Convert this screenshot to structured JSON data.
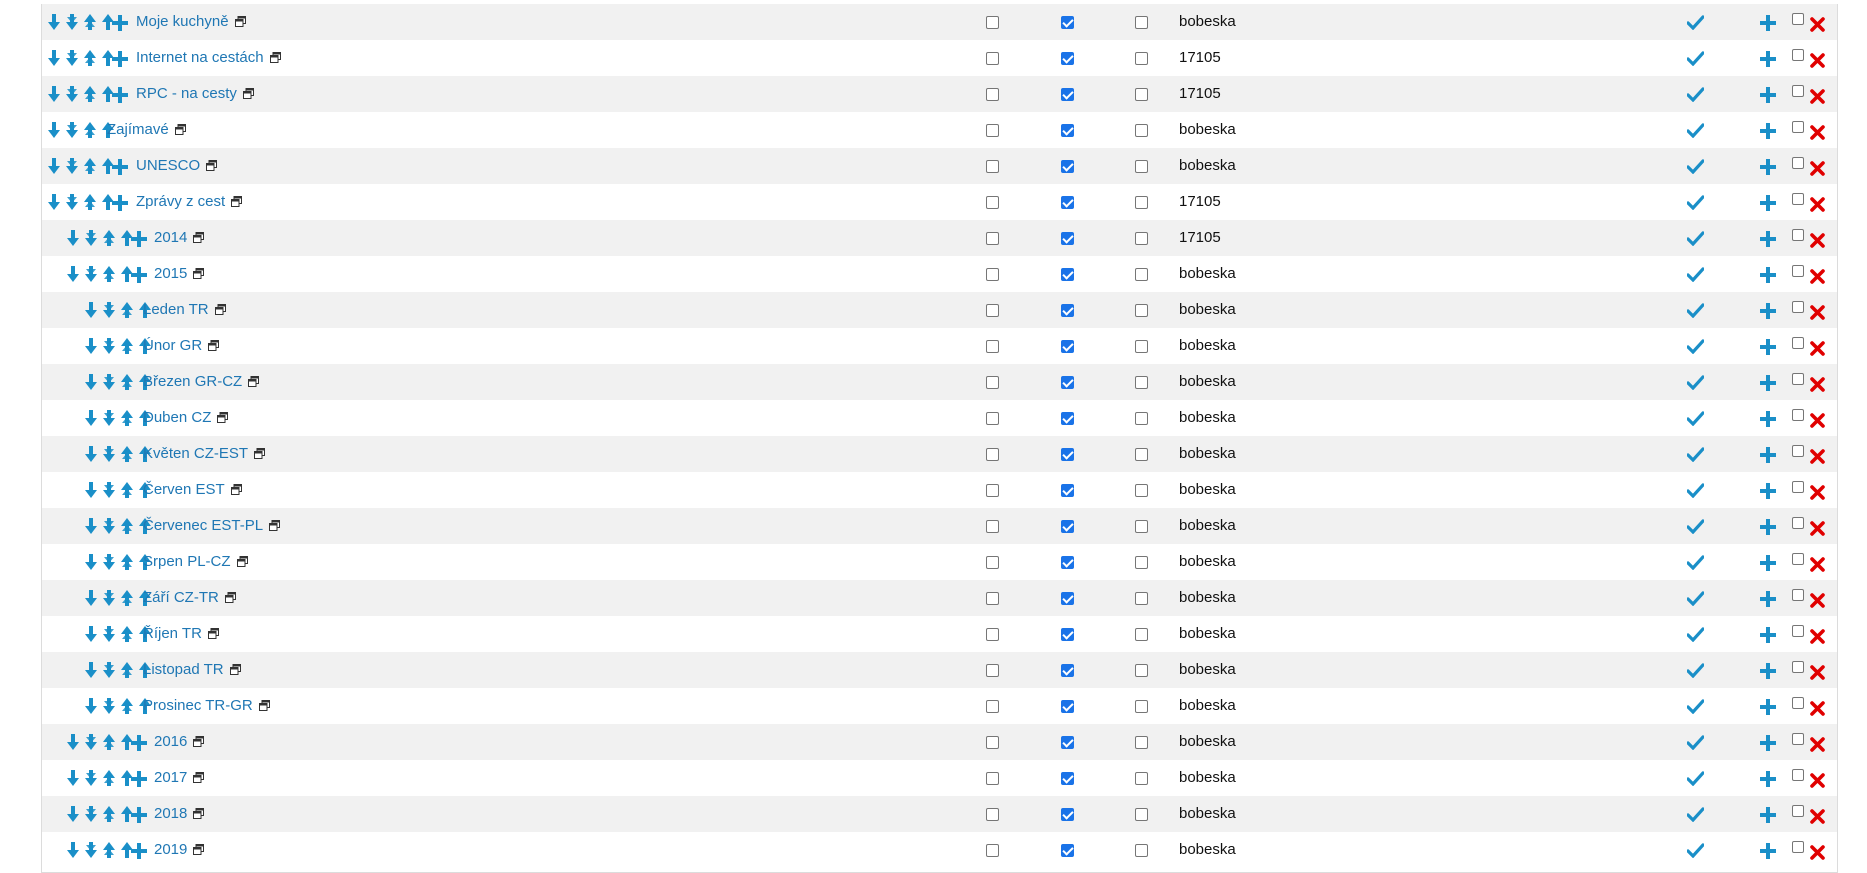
{
  "colors": {
    "link": "#1f77b4",
    "accent_blue": "#1a8fc8",
    "delete_red": "#e00000",
    "checkbox_on": "#1a73e8",
    "row_alt": "#f1f1f1"
  },
  "icons": {
    "move": [
      "arrow-down-icon",
      "arrow-down-fast-icon",
      "arrow-up-fast-icon",
      "arrow-up-icon"
    ],
    "add": "plus-icon",
    "open": "open-window-icon",
    "publish": "checkmark-icon",
    "delete": "red-x-icon"
  },
  "rows": [
    {
      "title": "Moje kuchyně",
      "level": 0,
      "plus": true,
      "cb1": false,
      "cb2": true,
      "cb3": false,
      "owner": "bobeska"
    },
    {
      "title": "Internet na cestách",
      "level": 0,
      "plus": true,
      "cb1": false,
      "cb2": true,
      "cb3": false,
      "owner": "17105"
    },
    {
      "title": "RPC - na cesty",
      "level": 0,
      "plus": true,
      "cb1": false,
      "cb2": true,
      "cb3": false,
      "owner": "17105"
    },
    {
      "title": "Zajímavé",
      "level": 0,
      "plus": false,
      "cb1": false,
      "cb2": true,
      "cb3": false,
      "owner": "bobeska"
    },
    {
      "title": "UNESCO",
      "level": 0,
      "plus": true,
      "cb1": false,
      "cb2": true,
      "cb3": false,
      "owner": "bobeska"
    },
    {
      "title": "Zprávy z cest",
      "level": 0,
      "plus": true,
      "cb1": false,
      "cb2": true,
      "cb3": false,
      "owner": "17105"
    },
    {
      "title": "2014",
      "level": 1,
      "plus": true,
      "cb1": false,
      "cb2": true,
      "cb3": false,
      "owner": "17105"
    },
    {
      "title": "2015",
      "level": 1,
      "plus": true,
      "cb1": false,
      "cb2": true,
      "cb3": false,
      "owner": "bobeska"
    },
    {
      "title": "Leden TR",
      "level": 2,
      "plus": false,
      "cb1": false,
      "cb2": true,
      "cb3": false,
      "owner": "bobeska"
    },
    {
      "title": "Únor GR",
      "level": 2,
      "plus": false,
      "cb1": false,
      "cb2": true,
      "cb3": false,
      "owner": "bobeska"
    },
    {
      "title": "Březen GR-CZ",
      "level": 2,
      "plus": false,
      "cb1": false,
      "cb2": true,
      "cb3": false,
      "owner": "bobeska"
    },
    {
      "title": "Duben CZ",
      "level": 2,
      "plus": false,
      "cb1": false,
      "cb2": true,
      "cb3": false,
      "owner": "bobeska"
    },
    {
      "title": "Květen CZ-EST",
      "level": 2,
      "plus": false,
      "cb1": false,
      "cb2": true,
      "cb3": false,
      "owner": "bobeska"
    },
    {
      "title": "Červen EST",
      "level": 2,
      "plus": false,
      "cb1": false,
      "cb2": true,
      "cb3": false,
      "owner": "bobeska"
    },
    {
      "title": "Červenec EST-PL",
      "level": 2,
      "plus": false,
      "cb1": false,
      "cb2": true,
      "cb3": false,
      "owner": "bobeska"
    },
    {
      "title": "Srpen PL-CZ",
      "level": 2,
      "plus": false,
      "cb1": false,
      "cb2": true,
      "cb3": false,
      "owner": "bobeska"
    },
    {
      "title": "Září CZ-TR",
      "level": 2,
      "plus": false,
      "cb1": false,
      "cb2": true,
      "cb3": false,
      "owner": "bobeska"
    },
    {
      "title": "Říjen TR",
      "level": 2,
      "plus": false,
      "cb1": false,
      "cb2": true,
      "cb3": false,
      "owner": "bobeska"
    },
    {
      "title": "Listopad TR",
      "level": 2,
      "plus": false,
      "cb1": false,
      "cb2": true,
      "cb3": false,
      "owner": "bobeska"
    },
    {
      "title": "Prosinec TR-GR",
      "level": 2,
      "plus": false,
      "cb1": false,
      "cb2": true,
      "cb3": false,
      "owner": "bobeska"
    },
    {
      "title": "2016",
      "level": 1,
      "plus": true,
      "cb1": false,
      "cb2": true,
      "cb3": false,
      "owner": "bobeska"
    },
    {
      "title": "2017",
      "level": 1,
      "plus": true,
      "cb1": false,
      "cb2": true,
      "cb3": false,
      "owner": "bobeska"
    },
    {
      "title": "2018",
      "level": 1,
      "plus": true,
      "cb1": false,
      "cb2": true,
      "cb3": false,
      "owner": "bobeska"
    },
    {
      "title": "2019",
      "level": 1,
      "plus": true,
      "cb1": false,
      "cb2": true,
      "cb3": false,
      "owner": "bobeska"
    }
  ]
}
